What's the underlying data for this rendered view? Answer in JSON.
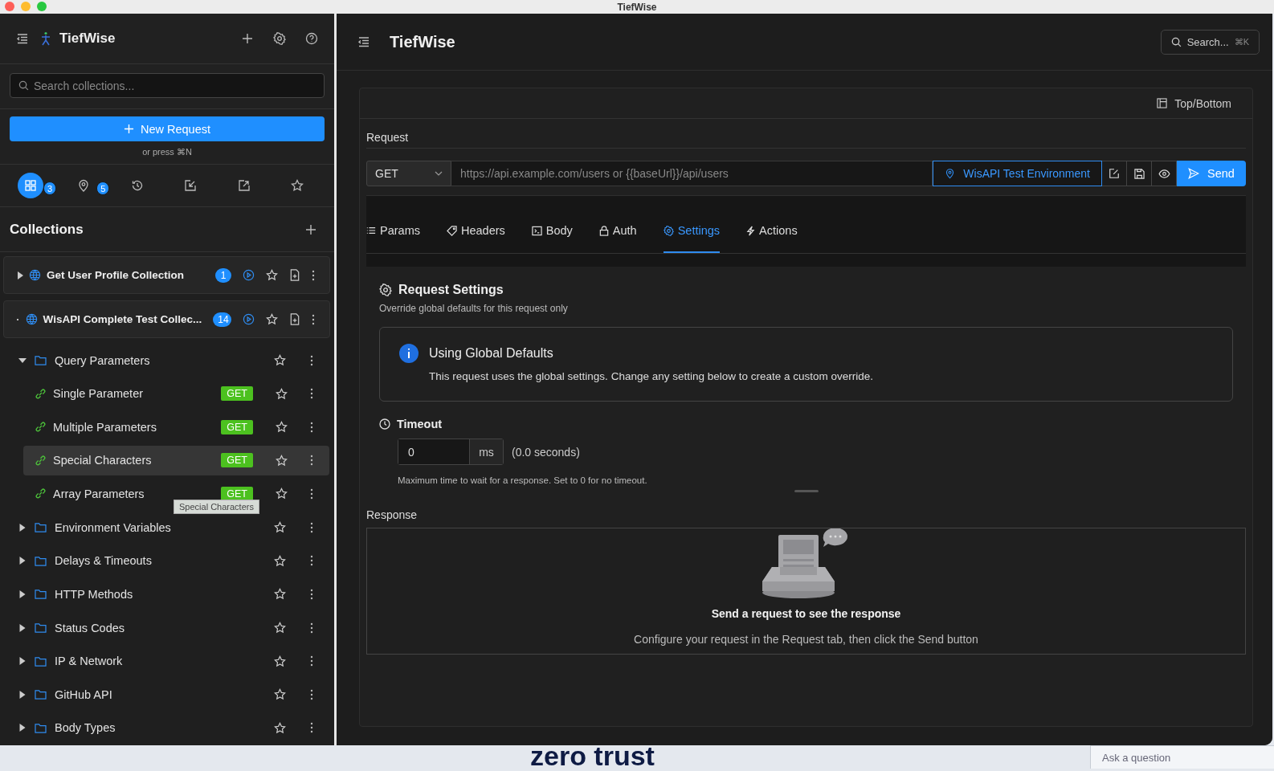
{
  "window": {
    "title": "TiefWise"
  },
  "sidebar": {
    "app_name": "TiefWise",
    "search": {
      "placeholder": "Search collections..."
    },
    "new_request": {
      "label": "New Request",
      "hint": "or press ⌘N"
    },
    "icon_tabs": [
      {
        "selected": true,
        "badge": "3"
      },
      {
        "selected": false,
        "badge": "5"
      },
      {
        "selected": false
      },
      {
        "selected": false
      },
      {
        "selected": false
      },
      {
        "selected": false
      }
    ],
    "collections_title": "Collections",
    "collections": [
      {
        "name": "Get User Profile Collection",
        "count": "1",
        "expanded": false
      },
      {
        "name": "WisAPI Complete Test Collec...",
        "count": "14",
        "expanded": true,
        "children": [
          {
            "kind": "folder",
            "name": "Query Parameters",
            "expanded": true,
            "children": [
              {
                "kind": "request",
                "name": "Single Parameter",
                "method": "GET",
                "selected": false
              },
              {
                "kind": "request",
                "name": "Multiple Parameters",
                "method": "GET",
                "selected": false
              },
              {
                "kind": "request",
                "name": "Special Characters",
                "method": "GET",
                "selected": true
              },
              {
                "kind": "request",
                "name": "Array Parameters",
                "method": "GET",
                "selected": false
              }
            ]
          },
          {
            "kind": "folder",
            "name": "Environment Variables",
            "expanded": false
          },
          {
            "kind": "folder",
            "name": "Delays & Timeouts",
            "expanded": false
          },
          {
            "kind": "folder",
            "name": "HTTP Methods",
            "expanded": false
          },
          {
            "kind": "folder",
            "name": "Status Codes",
            "expanded": false
          },
          {
            "kind": "folder",
            "name": "IP & Network",
            "expanded": false
          },
          {
            "kind": "folder",
            "name": "GitHub API",
            "expanded": false
          },
          {
            "kind": "folder",
            "name": "Body Types",
            "expanded": false
          }
        ]
      }
    ],
    "tooltip": "Special Characters"
  },
  "main": {
    "title": "TiefWise",
    "search": {
      "label": "Search...",
      "shortcut": "⌘K"
    },
    "layout_button": "Top/Bottom",
    "request_label": "Request",
    "method": "GET",
    "url": {
      "placeholder": "https://api.example.com/users or {{baseUrl}}/api/users"
    },
    "environment": "WisAPI Test Environment",
    "send": "Send",
    "tabs": [
      {
        "label": "Params",
        "selected": false
      },
      {
        "label": "Headers",
        "selected": false
      },
      {
        "label": "Body",
        "selected": false
      },
      {
        "label": "Auth",
        "selected": false
      },
      {
        "label": "Settings",
        "selected": true
      },
      {
        "label": "Actions",
        "selected": false
      }
    ],
    "settings": {
      "title": "Request Settings",
      "subtitle": "Override global defaults for this request only",
      "info_title": "Using Global Defaults",
      "info_text": "This request uses the global settings. Change any setting below to create a custom override.",
      "timeout": {
        "label": "Timeout",
        "value": "0",
        "unit": "ms",
        "reading": "(0.0 seconds)",
        "help": "Maximum time to wait for a response. Set to 0 for no timeout."
      }
    },
    "response": {
      "label": "Response",
      "empty_title": "Send a request to see the response",
      "empty_text": "Configure your request in the Request tab, then click the Send button"
    }
  },
  "background": {
    "heading": "zero trust",
    "ask": {
      "placeholder": "Ask a question"
    }
  }
}
